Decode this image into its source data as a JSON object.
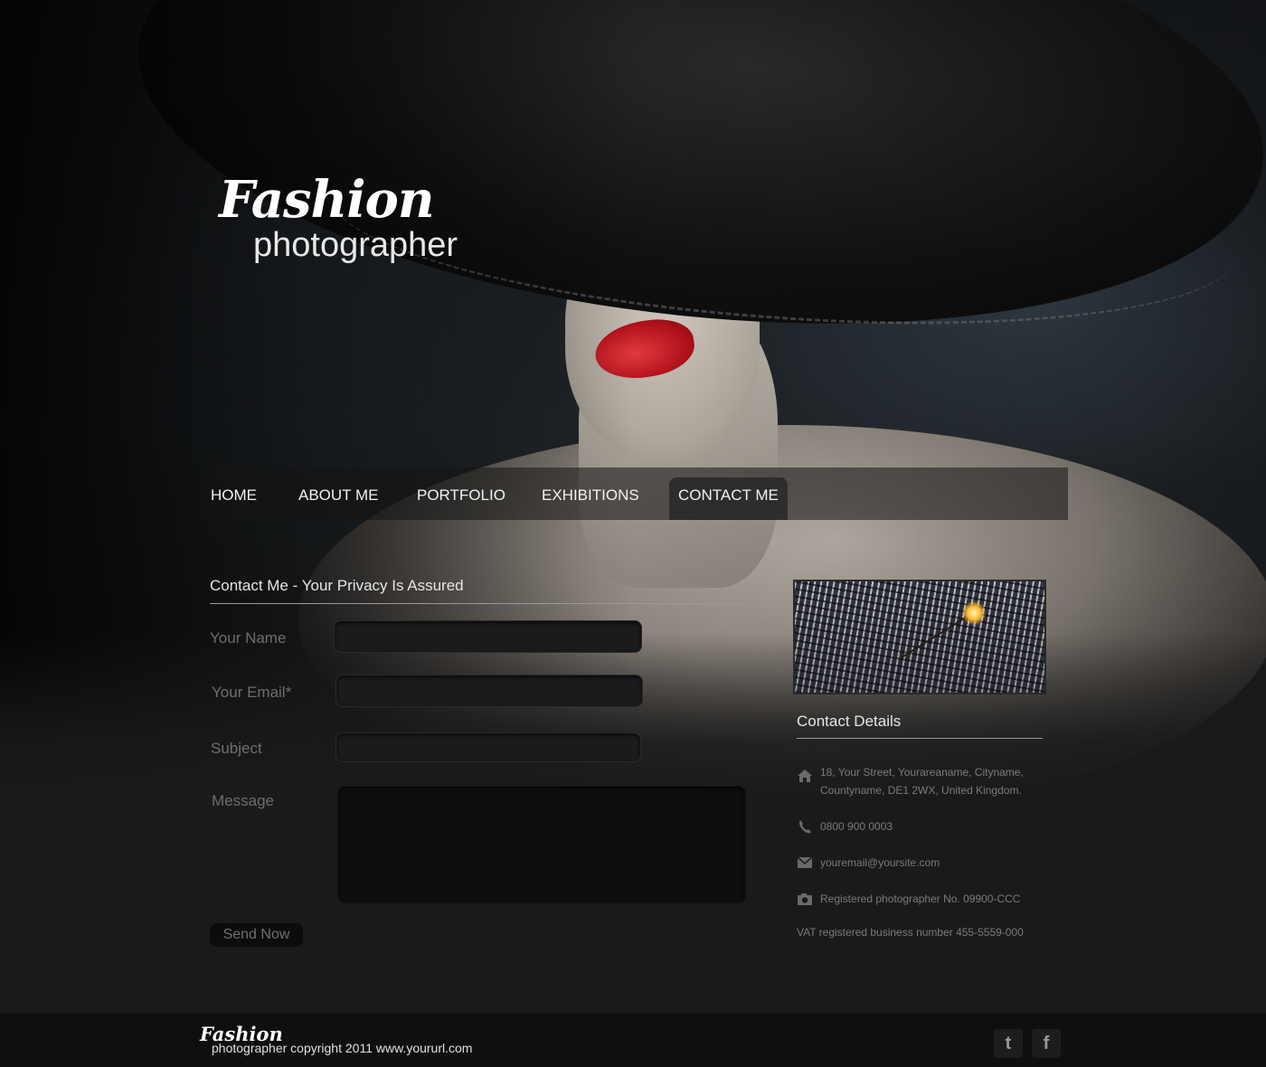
{
  "brand": {
    "logo_script": "Fashion",
    "logo_sub": "photographer"
  },
  "nav": {
    "items": [
      {
        "label": "HOME",
        "active": false
      },
      {
        "label": "ABOUT ME",
        "active": false
      },
      {
        "label": "PORTFOLIO",
        "active": false
      },
      {
        "label": "EXHIBITIONS",
        "active": false
      },
      {
        "label": "CONTACT ME",
        "active": true
      }
    ]
  },
  "contact_form": {
    "title": "Contact Me - Your Privacy Is Assured",
    "name_label": "Your Name",
    "name_value": "",
    "email_label": "Your Email*",
    "email_value": "",
    "subject_label": "Subject",
    "subject_value": "",
    "message_label": "Message",
    "message_value": "",
    "submit_label": "Send Now"
  },
  "contact_details": {
    "title": "Contact Details",
    "address_line1": "18, Your Street, Yourareaname, Cityname,",
    "address_line2": "Countyname, DE1 2WX, United Kingdom.",
    "phone": "0800 900 0003",
    "email": "youremail@yoursite.com",
    "registration": "Registered photographer No. 09900-CCC",
    "vat": "VAT registered business number 455-5559-000",
    "icons": [
      "home-icon",
      "phone-icon",
      "mail-icon",
      "camera-icon"
    ]
  },
  "footer": {
    "logo_script": "Fashion",
    "copyright": "photographer  copyright 2011 www.yoururl.com",
    "social": [
      {
        "icon": "twitter-icon",
        "glyph": "t"
      },
      {
        "icon": "facebook-icon",
        "glyph": "f"
      }
    ]
  },
  "colors": {
    "background": "#1a1a1a",
    "footer": "#0f0f0f",
    "lip_red": "#c8161f",
    "muted_text": "#7a7a7a"
  }
}
